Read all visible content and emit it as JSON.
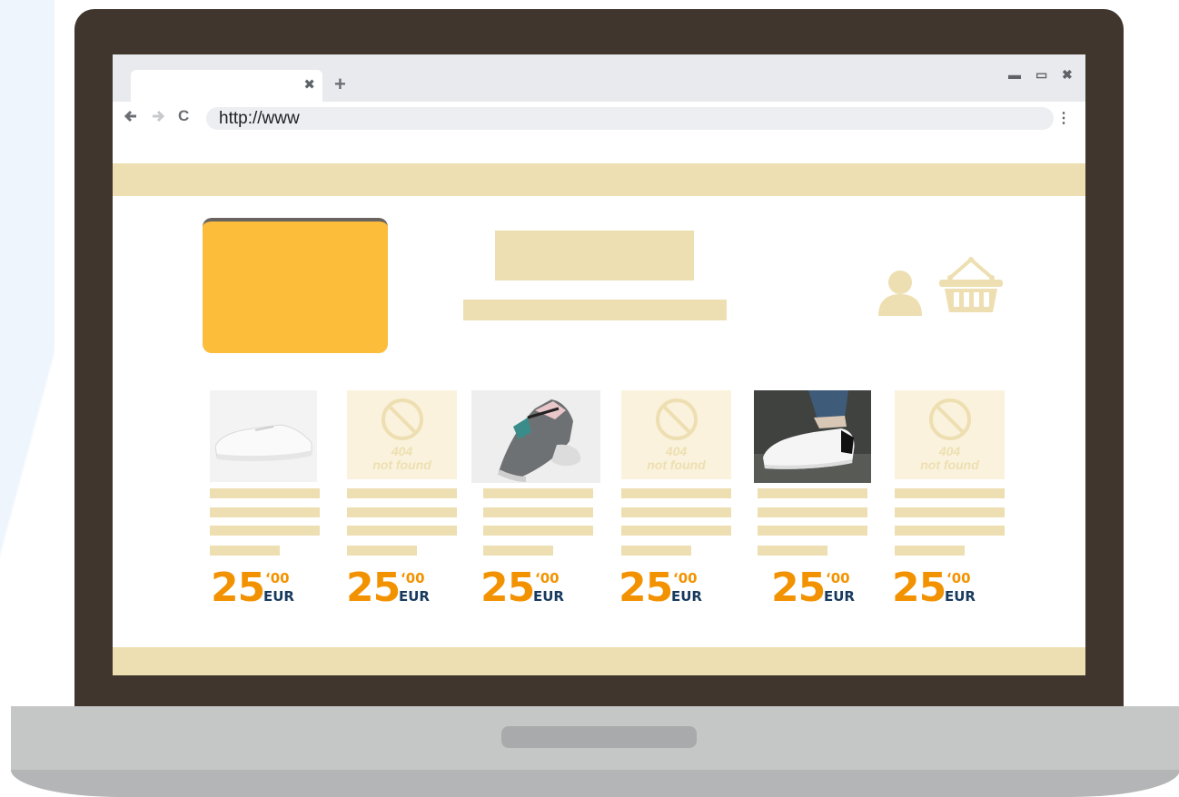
{
  "browser": {
    "tab_close": "✖",
    "new_tab": "+",
    "window_minimize": "▬",
    "window_maximize": "▭",
    "window_close": "✖",
    "back": "🡐",
    "forward": "🡒",
    "reload": "C",
    "url": "http://www",
    "menu": "⋮"
  },
  "site": {
    "icons": [
      "user-icon",
      "basket-icon"
    ],
    "products": [
      {
        "image": "white-sneaker-photo",
        "price_int": "25",
        "price_cents": "‘00",
        "currency": "EUR"
      },
      {
        "image": "404",
        "not_found_line1": "404",
        "not_found_line2": "not found",
        "price_int": "25",
        "price_cents": "‘00",
        "currency": "EUR"
      },
      {
        "image": "chunky-sneaker-photo",
        "price_int": "25",
        "price_cents": "‘00",
        "currency": "EUR"
      },
      {
        "image": "404",
        "not_found_line1": "404",
        "not_found_line2": "not found",
        "price_int": "25",
        "price_cents": "‘00",
        "currency": "EUR"
      },
      {
        "image": "worn-sneaker-photo",
        "price_int": "25",
        "price_cents": "‘00",
        "currency": "EUR"
      },
      {
        "image": "404",
        "not_found_line1": "404",
        "not_found_line2": "not found",
        "price_int": "25",
        "price_cents": "‘00",
        "currency": "EUR"
      }
    ]
  },
  "colors": {
    "bezel": "#40362e",
    "placeholder": "#eddfb1",
    "logo": "#fbbd3a",
    "price": "#f39200",
    "currency": "#173a5e"
  }
}
